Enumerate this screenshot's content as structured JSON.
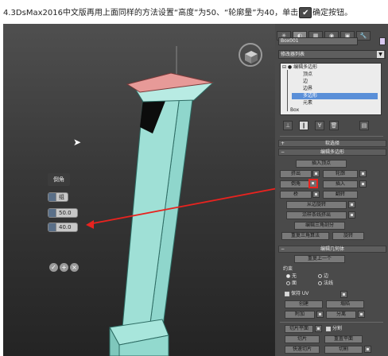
{
  "caption": {
    "text_before": "4.3DsMax2016中文版再用上面同样的方法设置“高度”为50、“轮廓量”为40，单击",
    "icon": "checkmark-ok-icon",
    "text_after": "确定按钮。"
  },
  "viewport": {
    "caddy": {
      "title": "倒角",
      "mode_value": "组",
      "height_value": "50.0",
      "outline_value": "40.0",
      "action_icons": [
        "ok-check-icon",
        "apply-plus-icon",
        "cancel-x-icon"
      ]
    },
    "nav_icon": "viewcube-icon",
    "colors": {
      "top_face": "#e79a98",
      "pillar_face": "#8fd6cc",
      "arrow": "#e8231f"
    }
  },
  "panel": {
    "toolbar_icons": [
      "create-tab",
      "modify-tab",
      "hierarchy-tab",
      "motion-tab",
      "display-tab",
      "utilities-tab"
    ],
    "object_name": "Box001",
    "modifier_list": "修改器列表",
    "stack": {
      "root": "编辑多边形",
      "subobjects": [
        "顶点",
        "边",
        "边界",
        "多边形",
        "元素"
      ],
      "selected": "多边形",
      "base": "Box"
    },
    "select_rollout": "软选择",
    "edit_poly_rollout": "编辑多边形",
    "edit_poly_buttons": {
      "insert_vertex": "插入顶点",
      "extrude": "挤出",
      "outline": "轮廓",
      "bevel": "倒角",
      "inset": "插入",
      "bridge": "桥",
      "flip": "翻转",
      "hinge": "从边旋转",
      "extrude_spline": "沿样条线挤出",
      "edit_tri": "编辑三角剖分",
      "retri": "重复三角算法",
      "turn": "旋转"
    },
    "geometry_rollout": "编辑几何体",
    "geometry": {
      "repeat_last": "重复上一个",
      "constraints": "约束",
      "constraint_options": [
        "无",
        "边",
        "面",
        "法线"
      ],
      "constraint_selected": "无",
      "preserve_uv": "保持 UV",
      "create": "创建",
      "collapse": "塌陷",
      "attach": "附加",
      "detach": "分离",
      "slice_plane": "切片平面",
      "split": "分割",
      "slice": "切片",
      "reset_plane": "重置平面",
      "quickslice": "快速切片",
      "cut": "切割"
    }
  }
}
